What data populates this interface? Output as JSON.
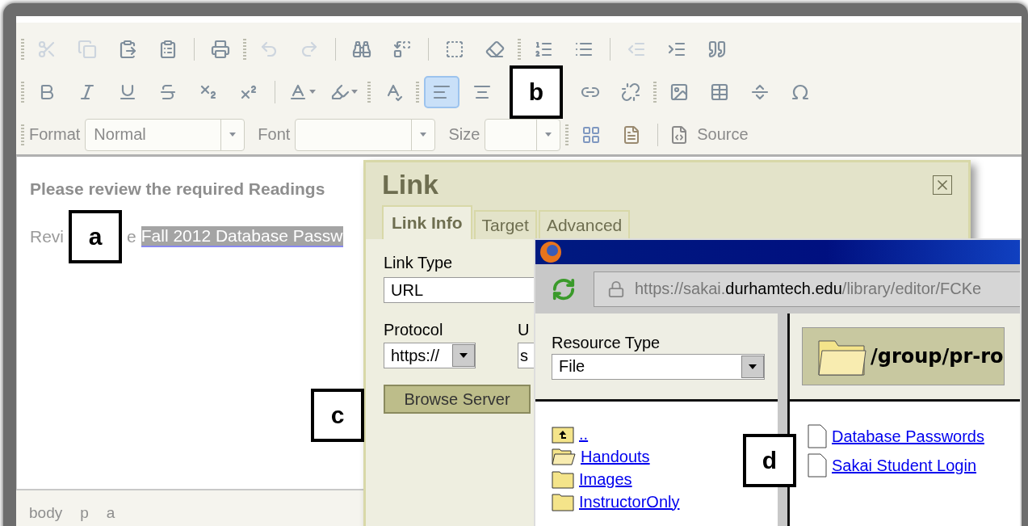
{
  "toolbar": {
    "row_1": [
      {
        "kind": "grip"
      },
      {
        "kind": "button",
        "disabled": true
      },
      {
        "kind": "button",
        "disabled": true
      },
      {
        "kind": "button",
        "disabled": false
      },
      {
        "kind": "button",
        "disabled": false
      },
      {
        "kind": "separator"
      },
      {
        "kind": "button",
        "disabled": false
      },
      {
        "kind": "grip"
      },
      {
        "kind": "button",
        "disabled": true
      },
      {
        "kind": "button",
        "disabled": true
      },
      {
        "kind": "separator"
      },
      {
        "kind": "button",
        "disabled": false
      },
      {
        "kind": "button",
        "disabled": false
      },
      {
        "kind": "separator"
      },
      {
        "kind": "button",
        "disabled": false
      },
      {
        "kind": "button",
        "disabled": false
      },
      {
        "kind": "grip"
      },
      {
        "kind": "button",
        "disabled": false
      },
      {
        "kind": "button",
        "disabled": false
      },
      {
        "kind": "separator"
      },
      {
        "kind": "button",
        "disabled": true
      },
      {
        "kind": "button",
        "disabled": false
      },
      {
        "kind": "button",
        "disabled": false
      }
    ],
    "row_2": [
      {
        "kind": "grip"
      },
      {
        "kind": "button",
        "selected": false
      },
      {
        "kind": "button",
        "selected": false
      },
      {
        "kind": "button",
        "selected": false
      },
      {
        "kind": "button",
        "selected": false
      },
      {
        "kind": "button",
        "selected": false
      },
      {
        "kind": "button",
        "selected": false
      },
      {
        "kind": "separator"
      },
      {
        "kind": "split",
        "selected": false
      },
      {
        "kind": "split",
        "selected": false
      },
      {
        "kind": "grip"
      },
      {
        "kind": "button",
        "selected": false
      },
      {
        "kind": "grip"
      },
      {
        "kind": "button",
        "selected": true
      },
      {
        "kind": "button",
        "selected": false
      },
      {
        "kind": "callout"
      },
      {
        "kind": "button",
        "selected": false
      },
      {
        "kind": "button",
        "selected": false
      },
      {
        "kind": "grip"
      },
      {
        "kind": "button",
        "selected": false
      },
      {
        "kind": "button",
        "selected": false
      },
      {
        "kind": "button",
        "selected": false
      },
      {
        "kind": "button",
        "selected": false
      }
    ],
    "row_3": {
      "format_label": "Format",
      "format_value": "Normal",
      "font_label": "Font",
      "size_label": "Size",
      "source_label": "Source"
    }
  },
  "editor": {
    "heading": "Please review the required Readings",
    "line_start": "Revi",
    "line_middle": "e",
    "link_text": "Fall 2012 Database Passw",
    "link_selected": true
  },
  "status_bar": [
    "body",
    "p",
    "a"
  ],
  "link_dialog": {
    "title": "Link",
    "tabs": [
      {
        "label": "Link Info",
        "selected": true
      },
      {
        "label": "Target",
        "selected": false
      },
      {
        "label": "Advanced",
        "selected": false
      }
    ],
    "link_type_label": "Link Type",
    "link_type_value": "URL",
    "protocol_label": "Protocol",
    "protocol_value": "https://",
    "url_label": "U",
    "url_value": "s",
    "browse_button": "Browse Server"
  },
  "browser_popup": {
    "address": "https://sakai.**durhamtech.edu**/library/editor/FCKe",
    "resource_type_label": "Resource Type",
    "resource_type_value": "File",
    "folders": [
      {
        "kind": "parent",
        "name": ".."
      },
      {
        "kind": "open",
        "name": "Handouts"
      },
      {
        "kind": "closed",
        "name": "Images"
      },
      {
        "kind": "closed",
        "name": "InstructorOnly"
      }
    ],
    "current_path": "/group/pr-ro",
    "files": [
      "Database Passwords",
      "Sakai Student Login"
    ]
  },
  "callouts": [
    "a",
    "b",
    "c",
    "d"
  ]
}
